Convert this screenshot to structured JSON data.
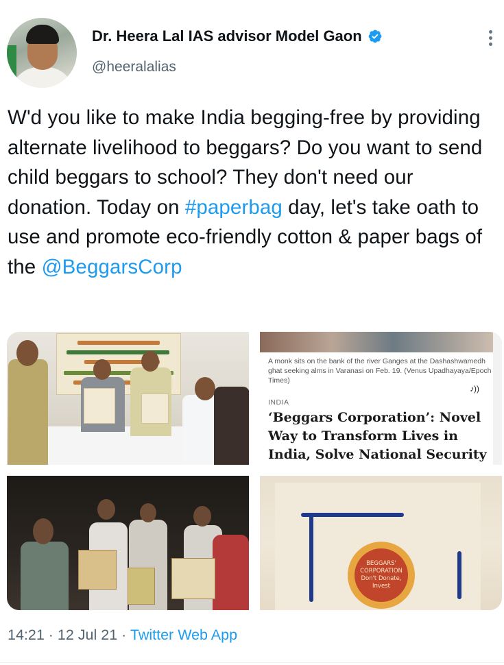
{
  "author": {
    "name": "Dr. Heera Lal IAS advisor Model Gaon",
    "handle": "@heeralalias",
    "verified": true
  },
  "icons": {
    "verified": "verified-badge-icon",
    "more": "more-options-icon"
  },
  "colors": {
    "link": "#1d9bf0",
    "text": "#0f1419",
    "secondary": "#536471"
  },
  "tweet": {
    "text_part1": "W'd you like to make India begging-free by providing alternate livelihood to beggars? Do you want to send child beggars to school? They don't need our donation. Today on ",
    "hashtag": "#paperbag",
    "text_part2": " day, let's take oath to use and promote eco-friendly cotton & paper bags of the ",
    "mention": "@BeggarsCorp"
  },
  "media": {
    "article": {
      "caption": "A monk sits on the bank of the river Ganges at the Dashashwamedh ghat seeking alms in Varanasi on Feb. 19. (Venus Upadhayaya/Epoch Times)",
      "category": "INDIA",
      "headline": "‘Beggars Corporation’: Novel Way to Transform Lives in India, Solve National Security",
      "sound_glyph": "♪))"
    },
    "bag_logo": {
      "line1": "BEGGARS'",
      "line2": "CORPORATION",
      "line3": "Don't Donate,",
      "line4": "Invest"
    }
  },
  "footer": {
    "time": "14:21",
    "sep1": " · ",
    "date": "12 Jul 21",
    "sep2": " · ",
    "app": "Twitter Web App"
  }
}
